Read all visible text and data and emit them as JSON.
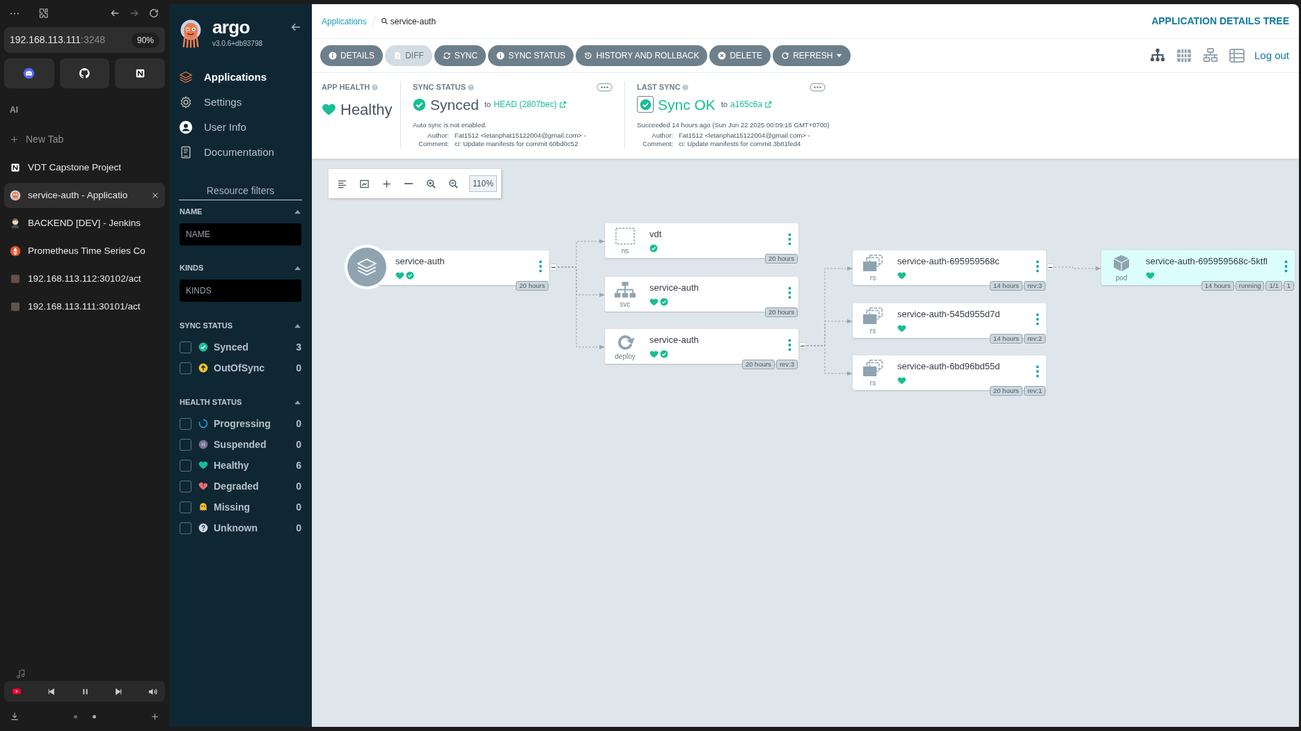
{
  "browser": {
    "address_host": "192.168.113.111",
    "address_rest": ":3248",
    "zoom": "90%",
    "section_label": "AI",
    "new_tab": "New Tab",
    "tabs": [
      {
        "title": "VDT Capstone Project",
        "kind": "notion",
        "selected": false
      },
      {
        "title": "service-auth - Applicatio",
        "kind": "argo",
        "selected": true
      },
      {
        "title": "BACKEND [DEV] - Jenkins",
        "kind": "jenkins",
        "selected": false
      },
      {
        "title": "Prometheus Time Series Co",
        "kind": "prometheus",
        "selected": false
      },
      {
        "title": "192.168.113.112:30102/act",
        "kind": "page",
        "selected": false
      },
      {
        "title": "192.168.113.111:30101/act",
        "kind": "page",
        "selected": false
      }
    ]
  },
  "sidebar": {
    "logo": "argo",
    "version": "v3.0.6+db93798",
    "items": [
      {
        "label": "Applications",
        "kind": "apps",
        "selected": true
      },
      {
        "label": "Settings",
        "kind": "settings",
        "selected": false
      },
      {
        "label": "User Info",
        "kind": "user",
        "selected": false
      },
      {
        "label": "Documentation",
        "kind": "docs",
        "selected": false
      }
    ],
    "filters_title": "Resource filters",
    "fields": [
      {
        "title": "NAME",
        "placeholder": "NAME"
      },
      {
        "title": "KINDS",
        "placeholder": "KINDS"
      }
    ],
    "groups": [
      {
        "title": "SYNC STATUS",
        "items": [
          {
            "label": "Synced",
            "kind": "synced",
            "count": "3",
            "checked": false
          },
          {
            "label": "OutOfSync",
            "kind": "outofsync",
            "count": "0",
            "checked": false
          }
        ]
      },
      {
        "title": "HEALTH STATUS",
        "items": [
          {
            "label": "Progressing",
            "kind": "progressing",
            "count": "0",
            "checked": false
          },
          {
            "label": "Suspended",
            "kind": "suspended",
            "count": "0",
            "checked": false
          },
          {
            "label": "Healthy",
            "kind": "healthy",
            "count": "6",
            "checked": false
          },
          {
            "label": "Degraded",
            "kind": "degraded",
            "count": "0",
            "checked": false
          },
          {
            "label": "Missing",
            "kind": "missing",
            "count": "0",
            "checked": false
          },
          {
            "label": "Unknown",
            "kind": "unknown",
            "count": "0",
            "checked": false
          }
        ]
      }
    ]
  },
  "breadcrumb": {
    "parent": "Applications",
    "current": "service-auth"
  },
  "page_title": "APPLICATION DETAILS TREE",
  "toolbar": [
    {
      "label": "DETAILS",
      "kind": "info",
      "disabled": false
    },
    {
      "label": "DIFF",
      "kind": "diff",
      "disabled": true
    },
    {
      "label": "SYNC",
      "kind": "sync",
      "disabled": false
    },
    {
      "label": "SYNC STATUS",
      "kind": "info",
      "disabled": false
    },
    {
      "label": "HISTORY AND ROLLBACK",
      "kind": "history",
      "disabled": false
    },
    {
      "label": "DELETE",
      "kind": "delete",
      "disabled": false
    },
    {
      "label": "REFRESH",
      "kind": "refresh",
      "disabled": false
    }
  ],
  "views": [
    {
      "kind": "tree",
      "selected": true
    },
    {
      "kind": "pods",
      "selected": false
    },
    {
      "kind": "network",
      "selected": false
    },
    {
      "kind": "list",
      "selected": false
    }
  ],
  "logout": "Log out",
  "app_health": {
    "label": "APP HEALTH",
    "status": "Healthy"
  },
  "sync_status": {
    "label": "SYNC STATUS",
    "status": "Synced",
    "to": "to",
    "revision": "HEAD (2807bec)",
    "note": "Auto sync is not enabled.",
    "author_label": "Author:",
    "author": "Fat1512 <letanphat15122004@gmail.com> -",
    "comment_label": "Comment:",
    "comment": "ci: Update manifests for commit 60bd0c52"
  },
  "last_sync": {
    "label": "LAST SYNC",
    "status": "Sync OK",
    "to": "to",
    "revision": "a165c6a",
    "note": "Succeeded 14 hours ago (Sun Jun 22 2025 00:09:16 GMT+0700)",
    "author_label": "Author:",
    "author": "Fat1512 <letanphat15122004@gmail.com> -",
    "comment_label": "Comment:",
    "comment": "ci: Update manifests for commit 3b81fed4"
  },
  "zoom_level": "110%",
  "tree": {
    "kind": "application",
    "name": "service-auth",
    "healthy": true,
    "synced": true,
    "badges": [
      "20 hours"
    ],
    "selected": false,
    "children": [
      {
        "kind": "ns",
        "label": "ns",
        "name": "vdt",
        "synced": true,
        "badges": [
          "20 hours"
        ],
        "selected": false
      },
      {
        "kind": "svc",
        "label": "svc",
        "name": "service-auth",
        "healthy": true,
        "synced": true,
        "badges": [
          "20 hours"
        ],
        "selected": false
      },
      {
        "kind": "deploy",
        "label": "deploy",
        "name": "service-auth",
        "healthy": true,
        "synced": true,
        "badges": [
          "20 hours",
          "rev:3"
        ],
        "selected": false,
        "children": [
          {
            "kind": "rs",
            "label": "rs",
            "name": "service-auth-695959568c",
            "healthy": true,
            "badges": [
              "14 hours",
              "rev:3"
            ],
            "selected": false,
            "children": [
              {
                "kind": "pod",
                "label": "pod",
                "name": "service-auth-695959568c-5ktfl",
                "healthy": true,
                "badges": [
                  "14 hours",
                  "running",
                  "1/1",
                  "1"
                ],
                "selected": true
              }
            ]
          },
          {
            "kind": "rs",
            "label": "rs",
            "name": "service-auth-545d955d7d",
            "healthy": true,
            "badges": [
              "14 hours",
              "rev:2"
            ],
            "selected": false
          },
          {
            "kind": "rs",
            "label": "rs",
            "name": "service-auth-6bd96bd55d",
            "healthy": true,
            "badges": [
              "20 hours",
              "rev:1"
            ],
            "selected": false
          }
        ]
      }
    ]
  }
}
